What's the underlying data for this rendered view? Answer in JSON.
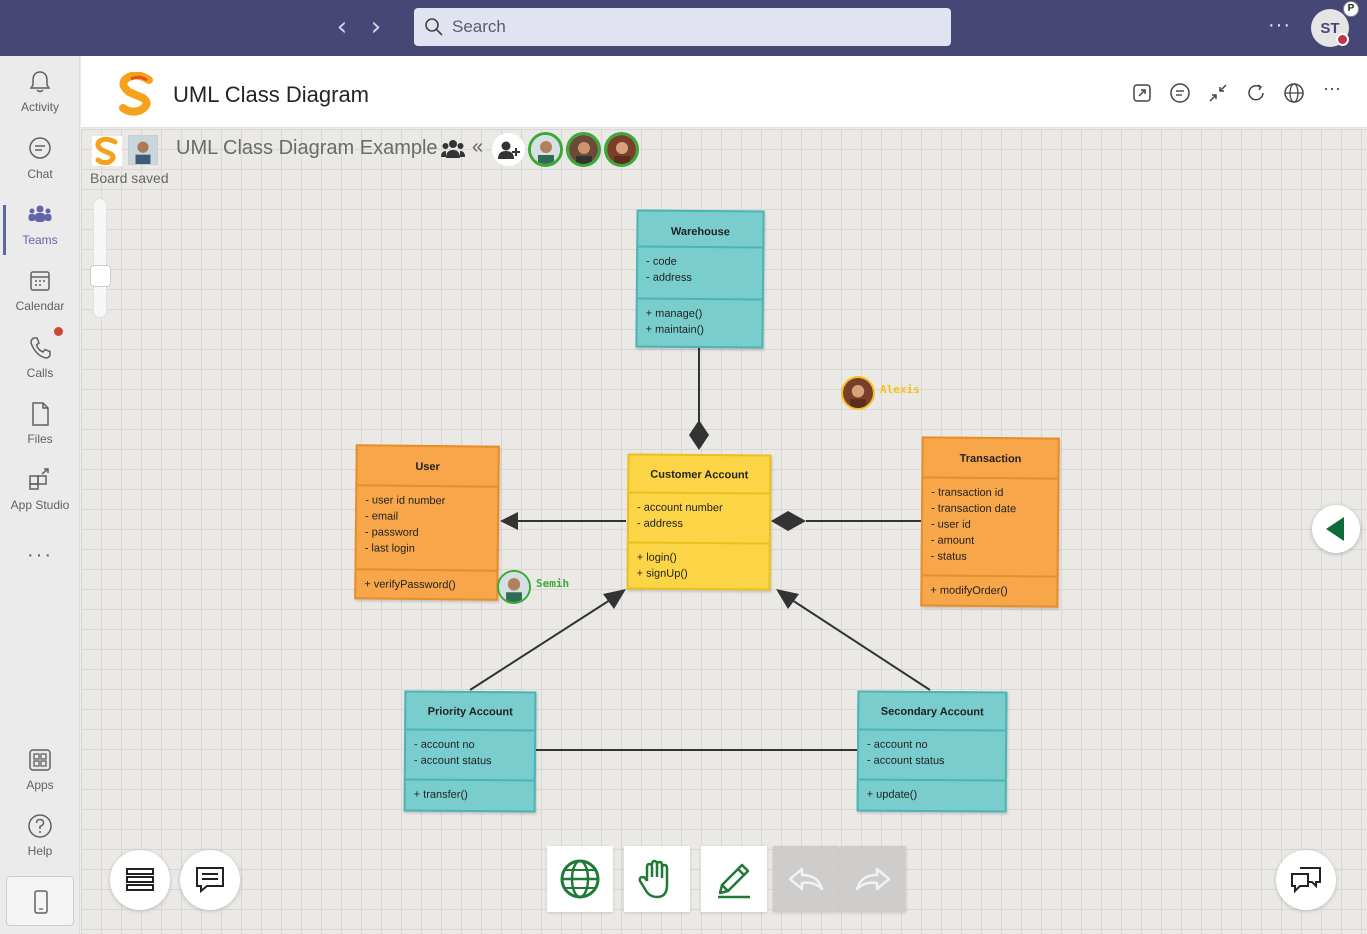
{
  "topbar": {
    "search_placeholder": "Search",
    "more_label": "···",
    "user_initials": "ST",
    "badge": "P"
  },
  "rail": {
    "items": [
      {
        "label": "Activity",
        "icon": "bell-icon"
      },
      {
        "label": "Chat",
        "icon": "chat-icon"
      },
      {
        "label": "Teams",
        "icon": "teams-icon",
        "active": true
      },
      {
        "label": "Calendar",
        "icon": "calendar-icon"
      },
      {
        "label": "Calls",
        "icon": "phone-icon",
        "notification": true
      },
      {
        "label": "Files",
        "icon": "file-icon"
      },
      {
        "label": "App Studio",
        "icon": "app-studio-icon"
      }
    ],
    "more": "···",
    "apps_label": "Apps",
    "help_label": "Help"
  },
  "app": {
    "title": "UML Class Diagram"
  },
  "board": {
    "title": "UML Class Diagram Example",
    "status": "Board saved",
    "collapse": "«"
  },
  "diagram": {
    "warehouse": {
      "name": "Warehouse",
      "attributes": [
        "- code",
        "- address"
      ],
      "methods": [
        "+ manage()",
        "+ maintain()"
      ]
    },
    "user": {
      "name": "User",
      "attributes": [
        "- user id number",
        "- email",
        "- password",
        "- last login"
      ],
      "methods": [
        "+ verifyPassword()"
      ]
    },
    "customer": {
      "name": "Customer Account",
      "attributes": [
        "- account number",
        "- address"
      ],
      "methods": [
        "+ login()",
        "+ signUp()"
      ]
    },
    "transaction": {
      "name": "Transaction",
      "attributes": [
        "- transaction id",
        "- transaction date",
        "- user id",
        "- amount",
        "- status"
      ],
      "methods": [
        "+ modifyOrder()"
      ]
    },
    "priority": {
      "name": "Priority Account",
      "attributes": [
        "- account no",
        "- account status"
      ],
      "methods": [
        "+ transfer()"
      ]
    },
    "secondary": {
      "name": "Secondary Account",
      "attributes": [
        "- account no",
        "- account status"
      ],
      "methods": [
        "+ update()"
      ]
    }
  },
  "cursors": {
    "alexis": "Alexis",
    "semih": "Semih"
  },
  "colors": {
    "teams_purple": "#464775",
    "teal_class": "#79cdcd",
    "orange_class": "#f7a64a",
    "yellow_class": "#fbd545",
    "tool_green": "#1e7a36"
  }
}
